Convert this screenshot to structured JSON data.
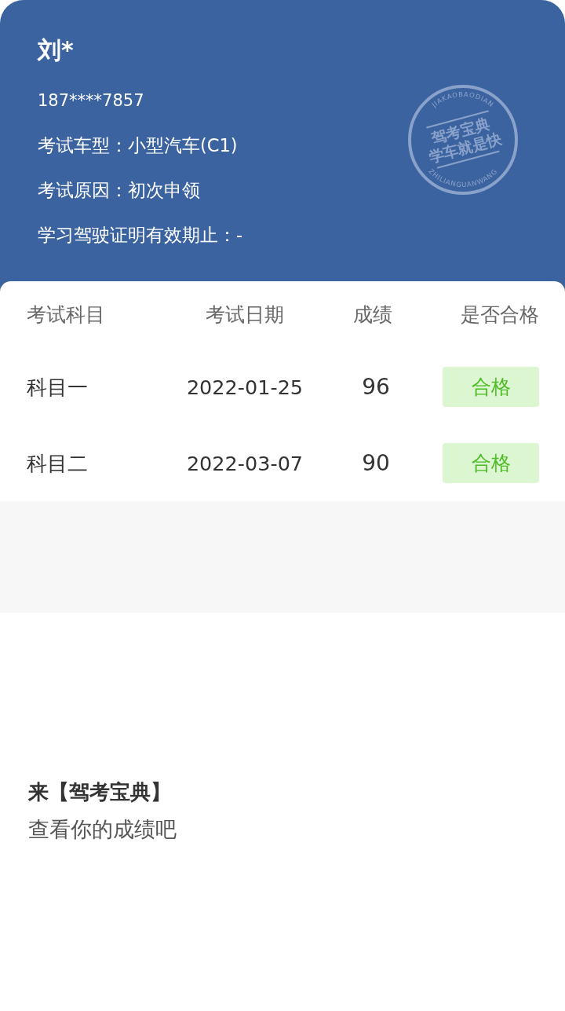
{
  "profile": {
    "name": "刘*",
    "phone": "187****7857",
    "details": [
      "考试车型：小型汽车(C1)",
      "考试原因：初次申领",
      "学习驾驶证明有效期止：-"
    ]
  },
  "stamp": {
    "top_text": "JIAKAOBAODIAN",
    "lines": [
      "驾考宝典",
      "学车就是快"
    ],
    "bottom_text": "ZHILIANGUANWANG"
  },
  "results_table": {
    "columns": [
      "考试科目",
      "考试日期",
      "成绩",
      "是否合格"
    ],
    "rows": [
      {
        "subject": "科目一",
        "date": "2022-01-25",
        "score": "96",
        "result": "合格",
        "passed": true
      },
      {
        "subject": "科目二",
        "date": "2022-03-07",
        "score": "90",
        "result": "合格",
        "passed": true
      }
    ]
  },
  "promo": {
    "title": "来【驾考宝典】",
    "subtitle": "查看你的成绩吧"
  }
}
